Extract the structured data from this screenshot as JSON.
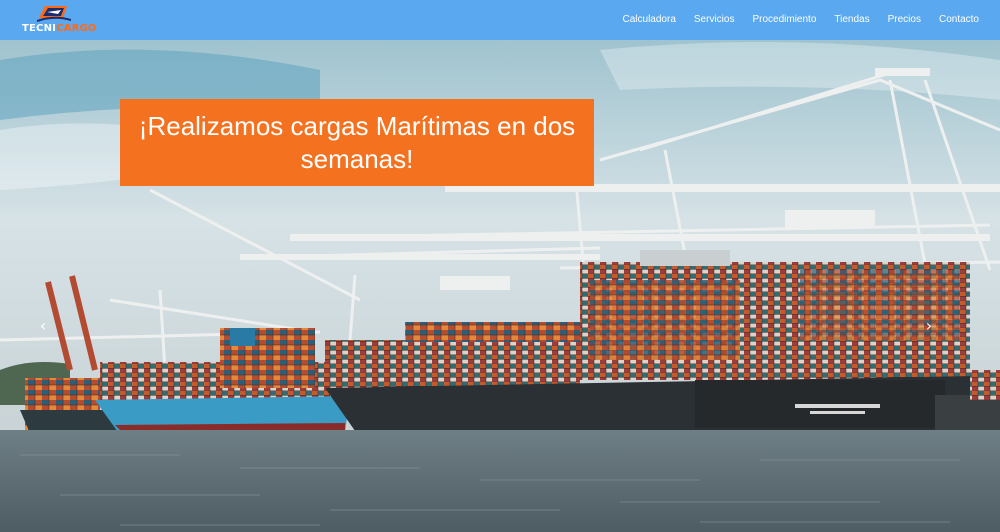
{
  "brand": {
    "logo_part1": "TECNI",
    "logo_part2": "CARGO",
    "logo_icon": "truck-plane-icon"
  },
  "nav": {
    "items": [
      {
        "label": "Calculadora"
      },
      {
        "label": "Servicios"
      },
      {
        "label": "Procedimiento"
      },
      {
        "label": "Tiendas"
      },
      {
        "label": "Precios"
      },
      {
        "label": "Contacto"
      }
    ]
  },
  "hero": {
    "headline": "¡Realizamos cargas Marítimas en dos semanas!",
    "image_subject": "container-ship-port-icon",
    "prev_icon": "chevron-left-icon",
    "next_icon": "chevron-right-icon",
    "prev_glyph": "‹",
    "next_glyph": "›"
  },
  "colors": {
    "navbar": "#5aa8f0",
    "accent": "#f4711f",
    "nav_text": "#ffffff"
  }
}
